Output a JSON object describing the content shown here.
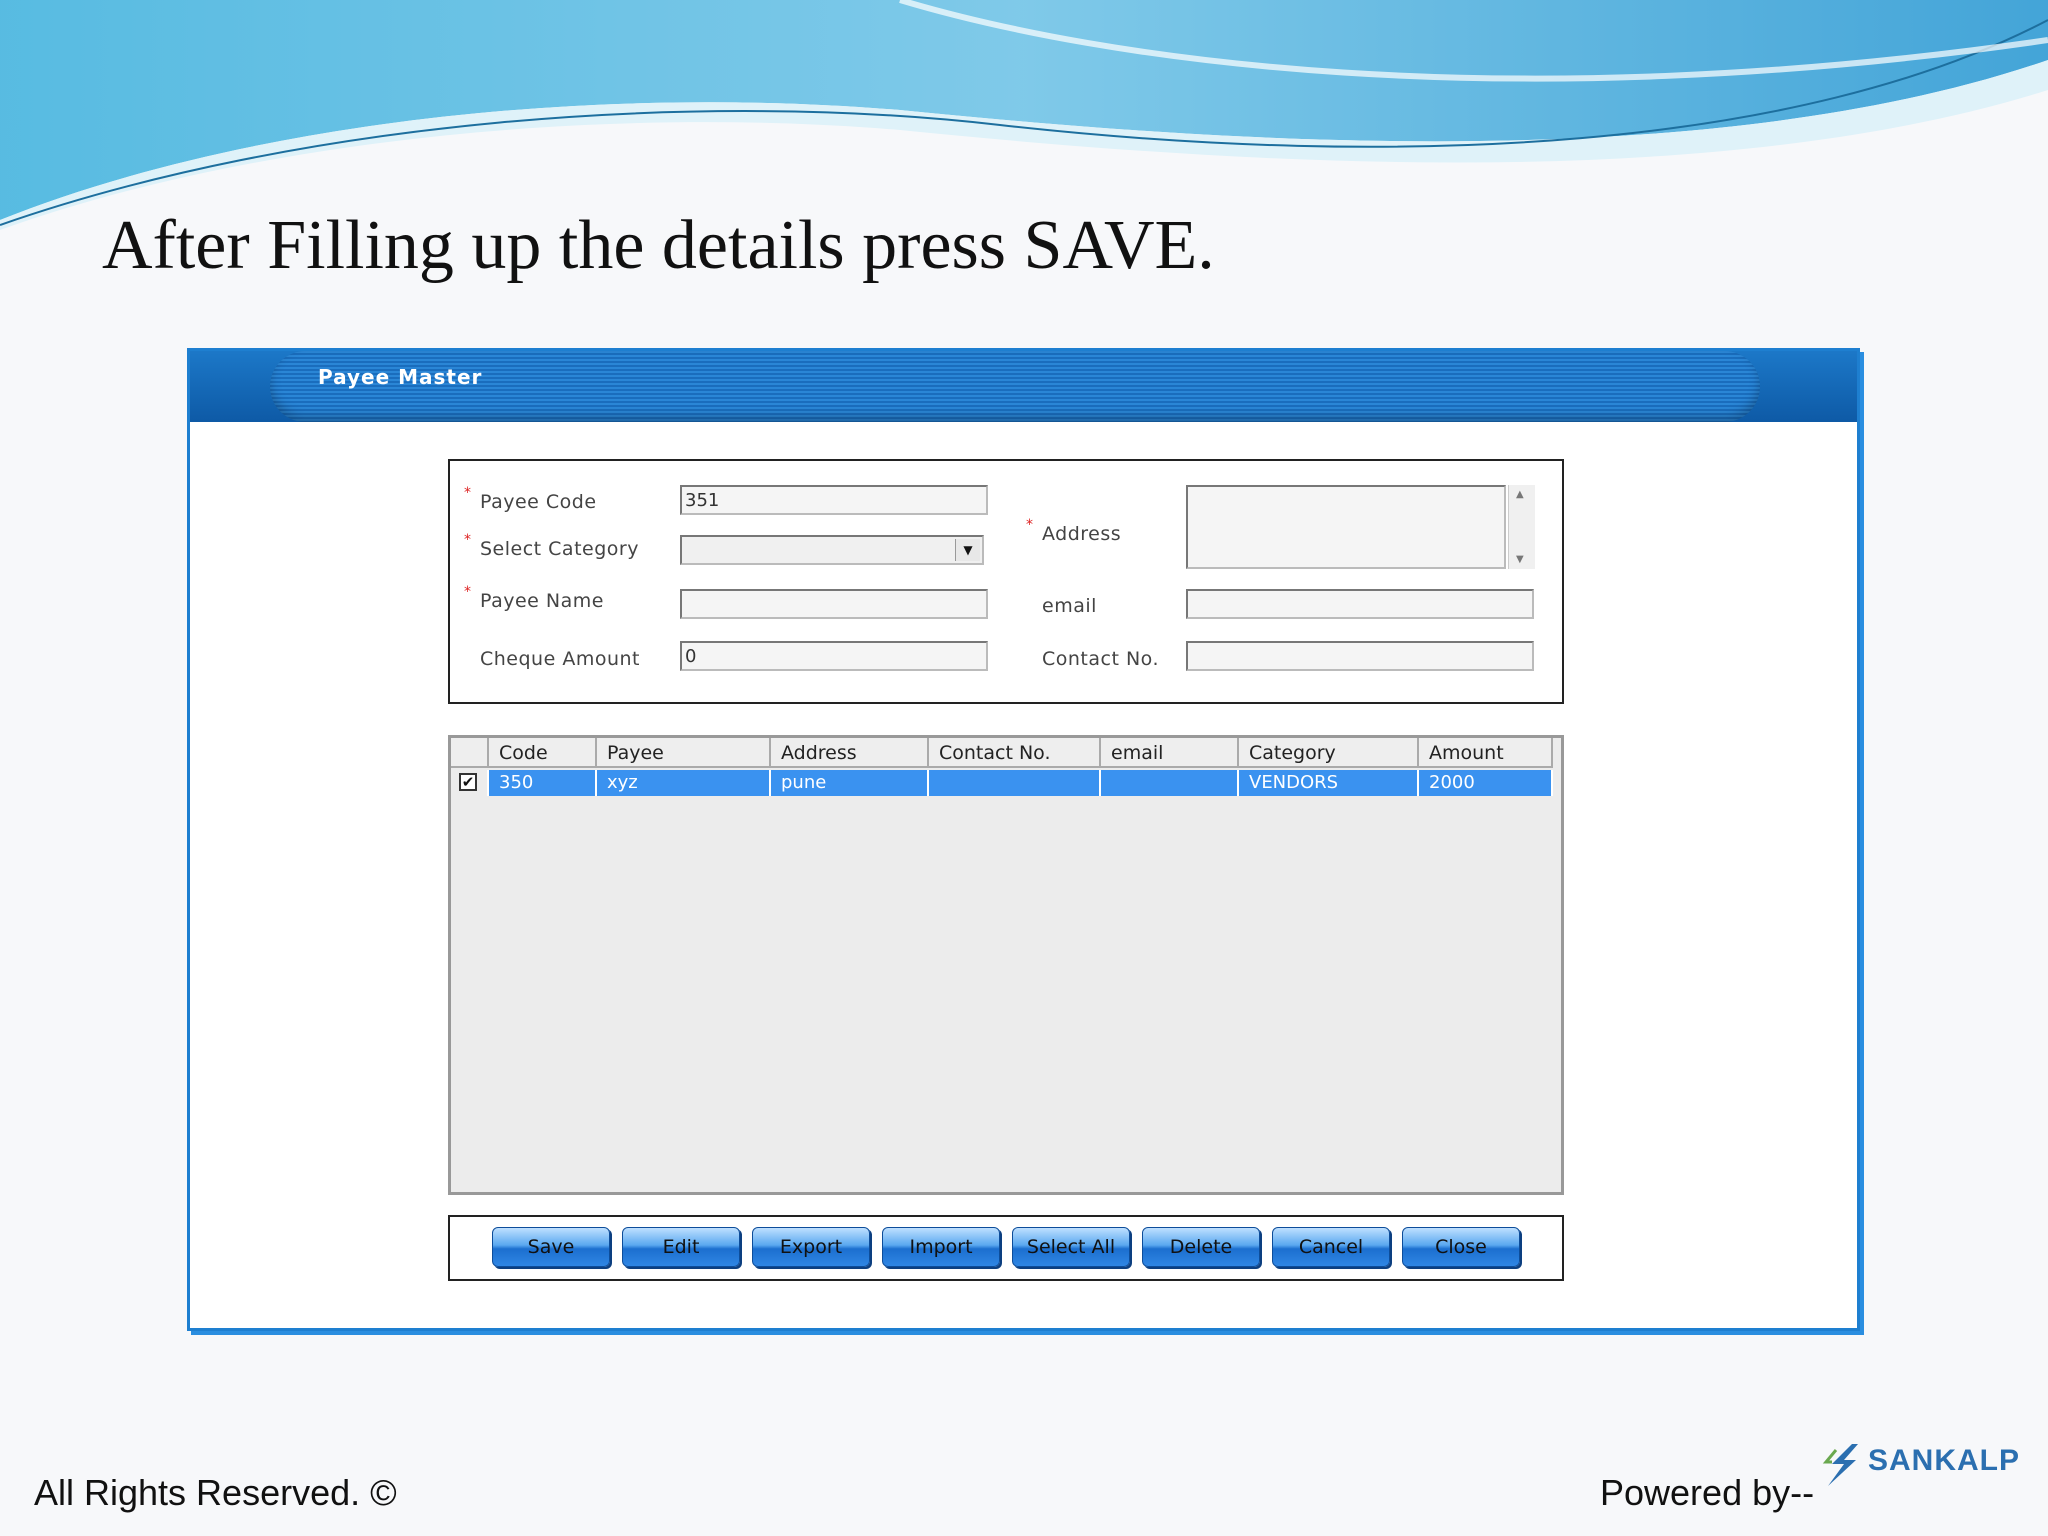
{
  "slide": {
    "title": "After Filling up the details press SAVE.",
    "footer_left": "All Rights Reserved. ©",
    "footer_right": "Powered by--",
    "logo_text": "SANKALP"
  },
  "window": {
    "title": "Payee Master"
  },
  "form": {
    "payee_code_label": "Payee Code",
    "payee_code_value": "351",
    "select_category_label": "Select Category",
    "select_category_value": "",
    "payee_name_label": "Payee Name",
    "payee_name_value": "",
    "cheque_amount_label": "Cheque Amount",
    "cheque_amount_value": "0",
    "address_label": "Address",
    "address_value": "",
    "email_label": "email",
    "email_value": "",
    "contact_label": "Contact No.",
    "contact_value": ""
  },
  "grid": {
    "columns": [
      "Code",
      "Payee",
      "Address",
      "Contact No.",
      "email",
      "Category",
      "Amount"
    ],
    "rows": [
      {
        "checked": true,
        "cells": [
          "350",
          "xyz",
          "pune",
          "",
          "",
          "VENDORS",
          "2000"
        ]
      }
    ]
  },
  "buttons": [
    "Save",
    "Edit",
    "Export",
    "Import",
    "Select All",
    "Delete",
    "Cancel",
    "Close"
  ],
  "colors": {
    "accent": "#1c78c8",
    "selected_row": "#3a92f0",
    "required_marker": "#d22222"
  }
}
